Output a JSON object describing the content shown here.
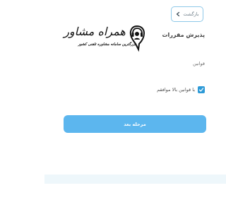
{
  "header": {
    "back_label": "بازگشت"
  },
  "logo": {
    "title": "همراه مشاور",
    "subtitle": "بزرگترین سامانه مشاوره تلفنی کشور"
  },
  "page": {
    "title": "پذیرش مقررات",
    "rules_label": "قوانین"
  },
  "agreement": {
    "checked": true,
    "label": "با قوانین بالا موافقم"
  },
  "actions": {
    "next_label": "مرحله بعد"
  },
  "colors": {
    "accent": "#5cb6ee",
    "checkbox": "#2d9ad7",
    "back_border": "#8ec8e8",
    "footer_strip": "#eef7fb"
  }
}
